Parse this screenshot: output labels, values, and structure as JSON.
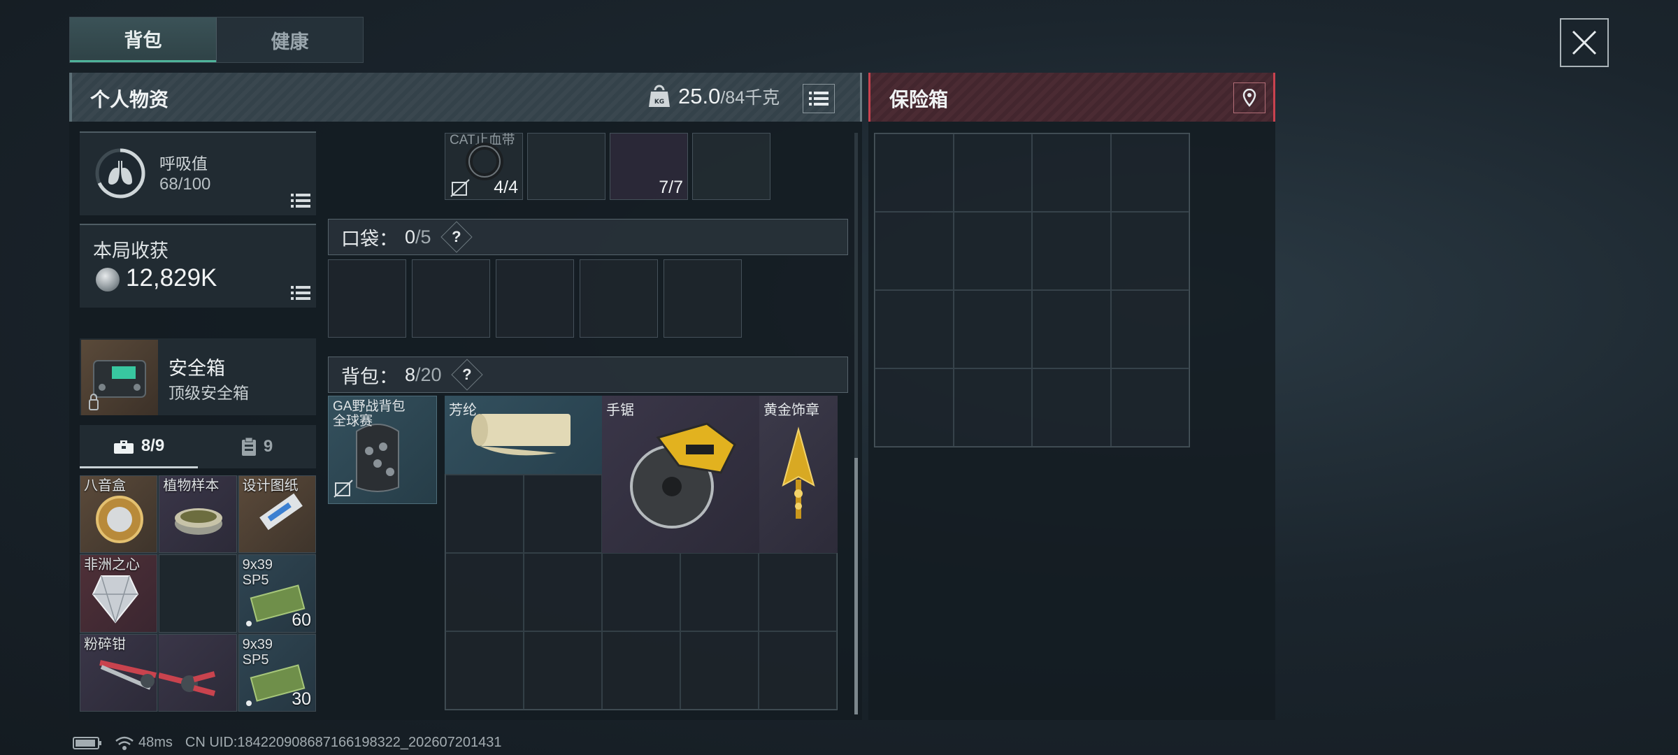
{
  "top_tabs": [
    {
      "label": "背包",
      "active": true
    },
    {
      "label": "健康",
      "active": false
    }
  ],
  "personal": {
    "title": "个人物资",
    "weight_current": "25.0",
    "weight_capacity": "/84千克"
  },
  "breath": {
    "label": "呼吸值",
    "value": "68/100",
    "level": 0.68
  },
  "harvest": {
    "label": "本局收获",
    "value": "12,829K"
  },
  "safebox": {
    "name": "安全箱",
    "subtitle": "顶级安全箱"
  },
  "pack_tabs": [
    {
      "label": "8/9",
      "icon": "toolbox-icon",
      "active": true
    },
    {
      "label": "9",
      "icon": "clipboard-icon",
      "active": false
    }
  ],
  "pack_items": [
    {
      "label": "八音盒",
      "count": "",
      "rarity": "gold"
    },
    {
      "label": "植物样本",
      "count": "",
      "rarity": "purple"
    },
    {
      "label": "设计图纸",
      "count": "",
      "rarity": "gold"
    },
    {
      "label": "非洲之心",
      "count": "",
      "rarity": "red"
    },
    {
      "label": "",
      "count": "",
      "rarity": "empty"
    },
    {
      "label": "9x39\nSP5",
      "count": "60",
      "rarity": "blue"
    },
    {
      "label": "粉碎钳",
      "count": "",
      "rarity": "purple"
    },
    {
      "label": "",
      "count": "",
      "rarity": "purple"
    },
    {
      "label": "9x39\nSP5",
      "count": "30",
      "rarity": "blue"
    }
  ],
  "top_slots": [
    {
      "label": "CAT止血带",
      "count": "4/4"
    },
    {
      "label": "",
      "count": ""
    },
    {
      "label": "",
      "count": "7/7"
    },
    {
      "label": "",
      "count": ""
    }
  ],
  "pocket": {
    "label": "口袋：",
    "count": "0",
    "capacity": "/5",
    "help": "?"
  },
  "bag": {
    "label": "背包：",
    "count": "8",
    "capacity": "/20",
    "help": "?"
  },
  "backpack_item": {
    "label": "GA野战背包\n全球赛"
  },
  "bag_items": {
    "aramid": "芳纶",
    "saw": "手锯",
    "gold": "黄金饰章"
  },
  "safe": {
    "title": "保险箱"
  },
  "status": {
    "ping": "48ms",
    "uid": "CN UID:18422090868716619832​2_202607201431"
  }
}
